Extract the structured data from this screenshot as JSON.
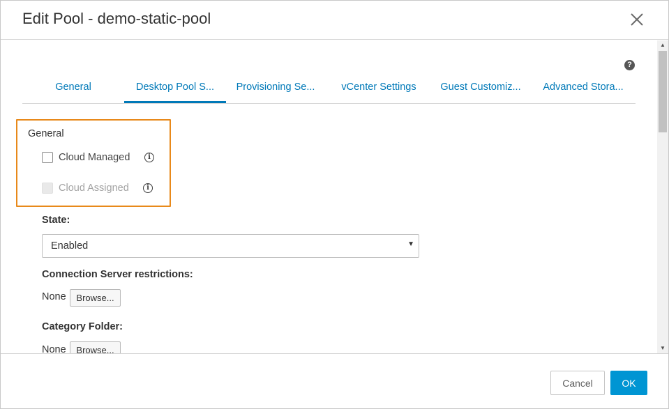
{
  "dialog": {
    "title": "Edit Pool - demo-static-pool"
  },
  "help": {
    "glyph": "?"
  },
  "tabs": [
    {
      "label": "General",
      "active": false
    },
    {
      "label": "Desktop Pool S...",
      "active": true
    },
    {
      "label": "Provisioning Se...",
      "active": false
    },
    {
      "label": "vCenter Settings",
      "active": false
    },
    {
      "label": "Guest Customiz...",
      "active": false
    },
    {
      "label": "Advanced Stora...",
      "active": false
    }
  ],
  "general": {
    "heading": "General",
    "cloud_managed": {
      "label": "Cloud Managed",
      "checked": false,
      "disabled": false
    },
    "cloud_assigned": {
      "label": "Cloud Assigned",
      "checked": false,
      "disabled": true
    },
    "info_glyph": "i"
  },
  "state": {
    "label": "State:",
    "value": "Enabled",
    "caret": "▼"
  },
  "connection_server": {
    "label": "Connection Server restrictions:",
    "value": "None",
    "browse_label": "Browse..."
  },
  "category_folder": {
    "label": "Category Folder:",
    "value": "None",
    "browse_label": "Browse..."
  },
  "scrollbar": {
    "up": "▲",
    "down": "▼"
  },
  "footer": {
    "cancel_label": "Cancel",
    "ok_label": "OK"
  },
  "colors": {
    "accent": "#0079b8",
    "primary_button": "#0095d3",
    "highlight_border": "#e8891a"
  }
}
